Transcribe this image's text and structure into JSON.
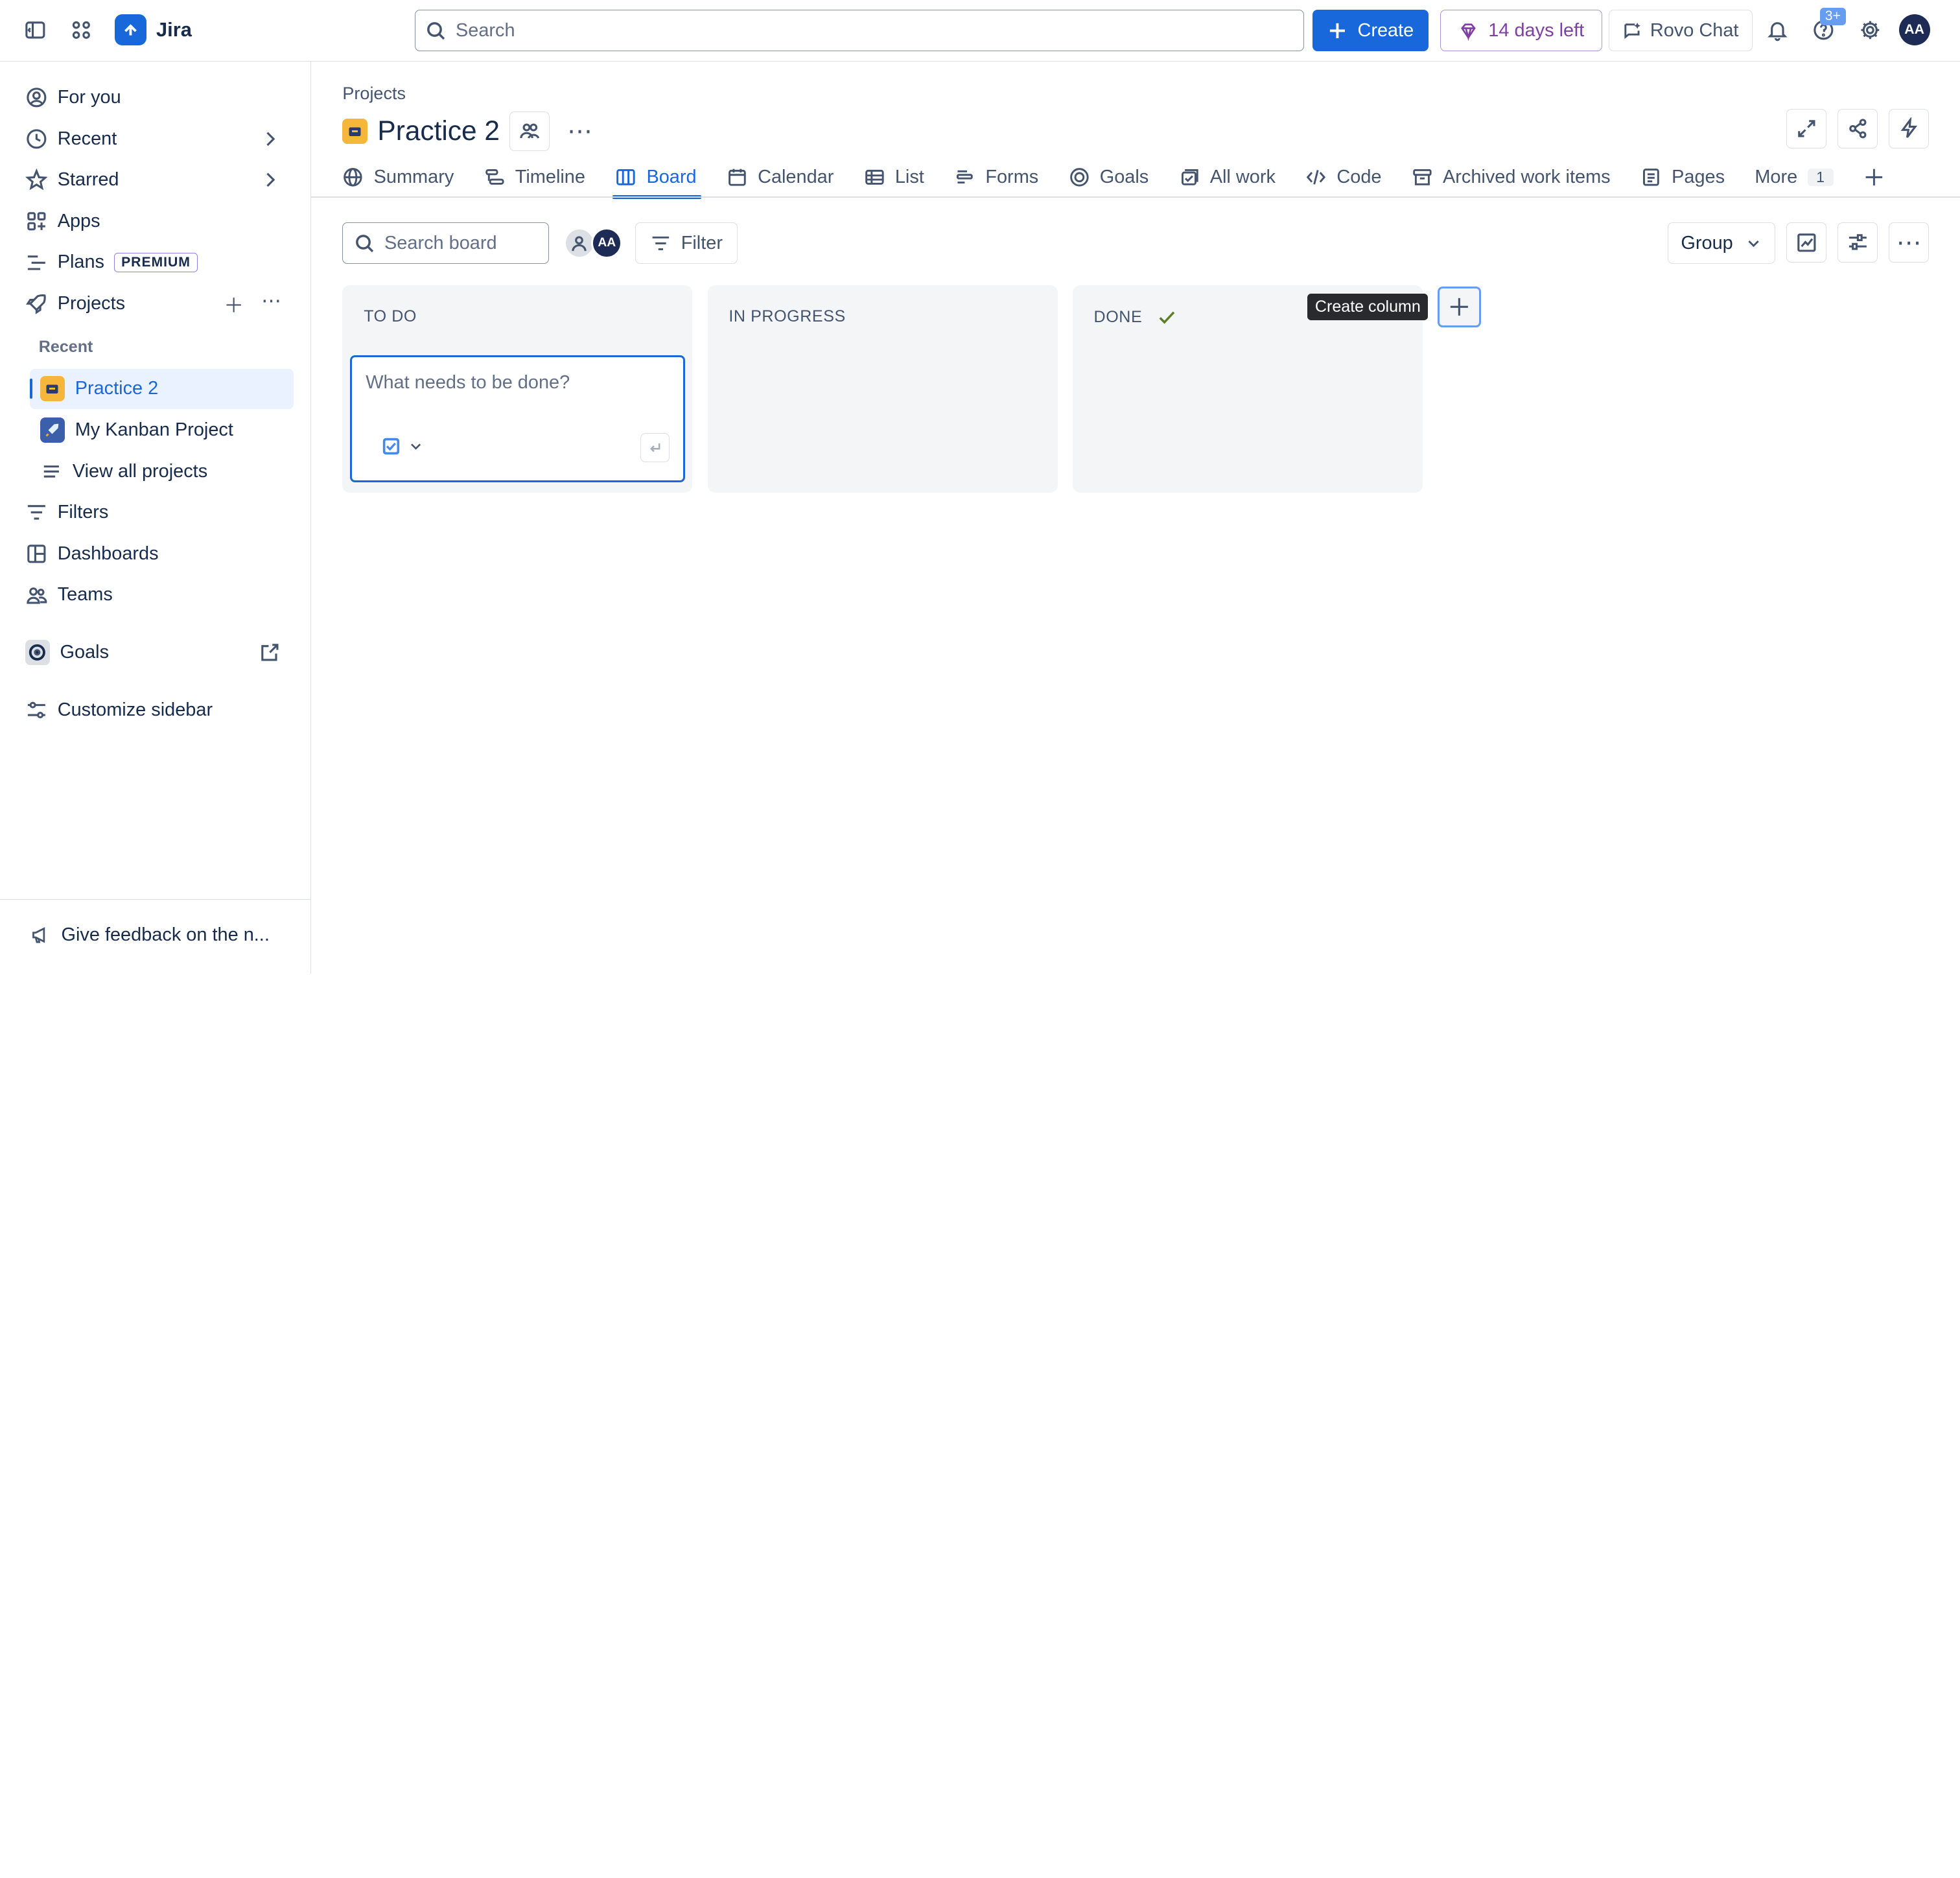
{
  "app": {
    "name": "Jira"
  },
  "topbar": {
    "search_placeholder": "Search",
    "create_label": "Create",
    "trial_label": "14 days left",
    "rovo_label": "Rovo Chat",
    "notifications_badge": "3+",
    "avatar_initials": "AA"
  },
  "sidebar": {
    "items": [
      {
        "label": "For you",
        "icon": "user-circle-icon"
      },
      {
        "label": "Recent",
        "icon": "clock-icon"
      },
      {
        "label": "Starred",
        "icon": "star-icon"
      },
      {
        "label": "Apps",
        "icon": "apps-icon"
      },
      {
        "label": "Plans",
        "icon": "plans-icon",
        "badge": "PREMIUM"
      },
      {
        "label": "Projects",
        "icon": "rocket-icon"
      }
    ],
    "recent_header": "Recent",
    "projects": [
      {
        "label": "Practice 2",
        "active": true
      },
      {
        "label": "My Kanban Project",
        "active": false
      }
    ],
    "view_all": "View all projects",
    "lower_items": [
      {
        "label": "Filters"
      },
      {
        "label": "Dashboards"
      },
      {
        "label": "Teams"
      }
    ],
    "goals": "Goals",
    "customize": "Customize sidebar",
    "feedback": "Give feedback on the n..."
  },
  "main": {
    "breadcrumb": "Projects",
    "title": "Practice 2",
    "tabs": [
      {
        "label": "Summary"
      },
      {
        "label": "Timeline"
      },
      {
        "label": "Board"
      },
      {
        "label": "Calendar"
      },
      {
        "label": "List"
      },
      {
        "label": "Forms"
      },
      {
        "label": "Goals"
      },
      {
        "label": "All work"
      },
      {
        "label": "Code"
      },
      {
        "label": "Archived work items"
      },
      {
        "label": "Pages"
      }
    ],
    "more_label": "More",
    "more_count": "1",
    "board": {
      "search_placeholder": "Search board",
      "assignee_initials": "AA",
      "filter_label": "Filter",
      "group_label": "Group",
      "columns": [
        {
          "title": "TO DO"
        },
        {
          "title": "IN PROGRESS"
        },
        {
          "title": "DONE"
        }
      ],
      "composer_placeholder": "What needs to be done?",
      "tooltip": "Create column"
    }
  }
}
